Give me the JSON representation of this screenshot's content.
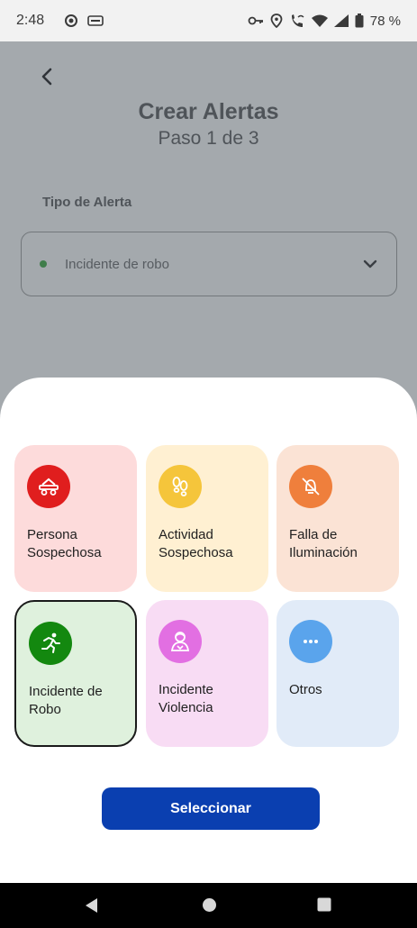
{
  "status_bar": {
    "time": "2:48",
    "battery": "78 %",
    "icons": [
      "settings-icon",
      "keyboard-icon",
      "key-icon",
      "location-icon",
      "wifi-call-icon",
      "wifi-icon",
      "signal-icon",
      "battery-icon"
    ]
  },
  "header": {
    "title": "Crear Alertas",
    "step": "Paso 1 de 3"
  },
  "form": {
    "field_label": "Tipo de Alerta",
    "selected_value": "Incidente de robo"
  },
  "sheet": {
    "options": [
      {
        "label": "Persona\nSospechosa",
        "icon": "suspicious-person-icon",
        "bg": "#fddbdb",
        "icon_bg": "#e01e1e"
      },
      {
        "label": "Actividad\nSospechosa",
        "icon": "footprints-icon",
        "bg": "#fff0d2",
        "icon_bg": "#f5c53b"
      },
      {
        "label": "Falla de\nIluminación",
        "icon": "light-off-icon",
        "bg": "#fbe3d5",
        "icon_bg": "#ef7f3c"
      },
      {
        "label": "Incidente de\nRobo",
        "icon": "running-person-icon",
        "bg": "#dff1dd",
        "icon_bg": "#13880f",
        "selected": true
      },
      {
        "label": "Incidente\nViolencia",
        "icon": "violence-icon",
        "bg": "#f8dcf4",
        "icon_bg": "#e26fe2"
      },
      {
        "label": "Otros",
        "icon": "more-dots-icon",
        "bg": "#e1ebf8",
        "icon_bg": "#5aa4ec"
      }
    ],
    "button_label": "Seleccionar"
  },
  "colors": {
    "primary": "#0a3fb0",
    "dim_overlay": "#a4a9ad"
  }
}
